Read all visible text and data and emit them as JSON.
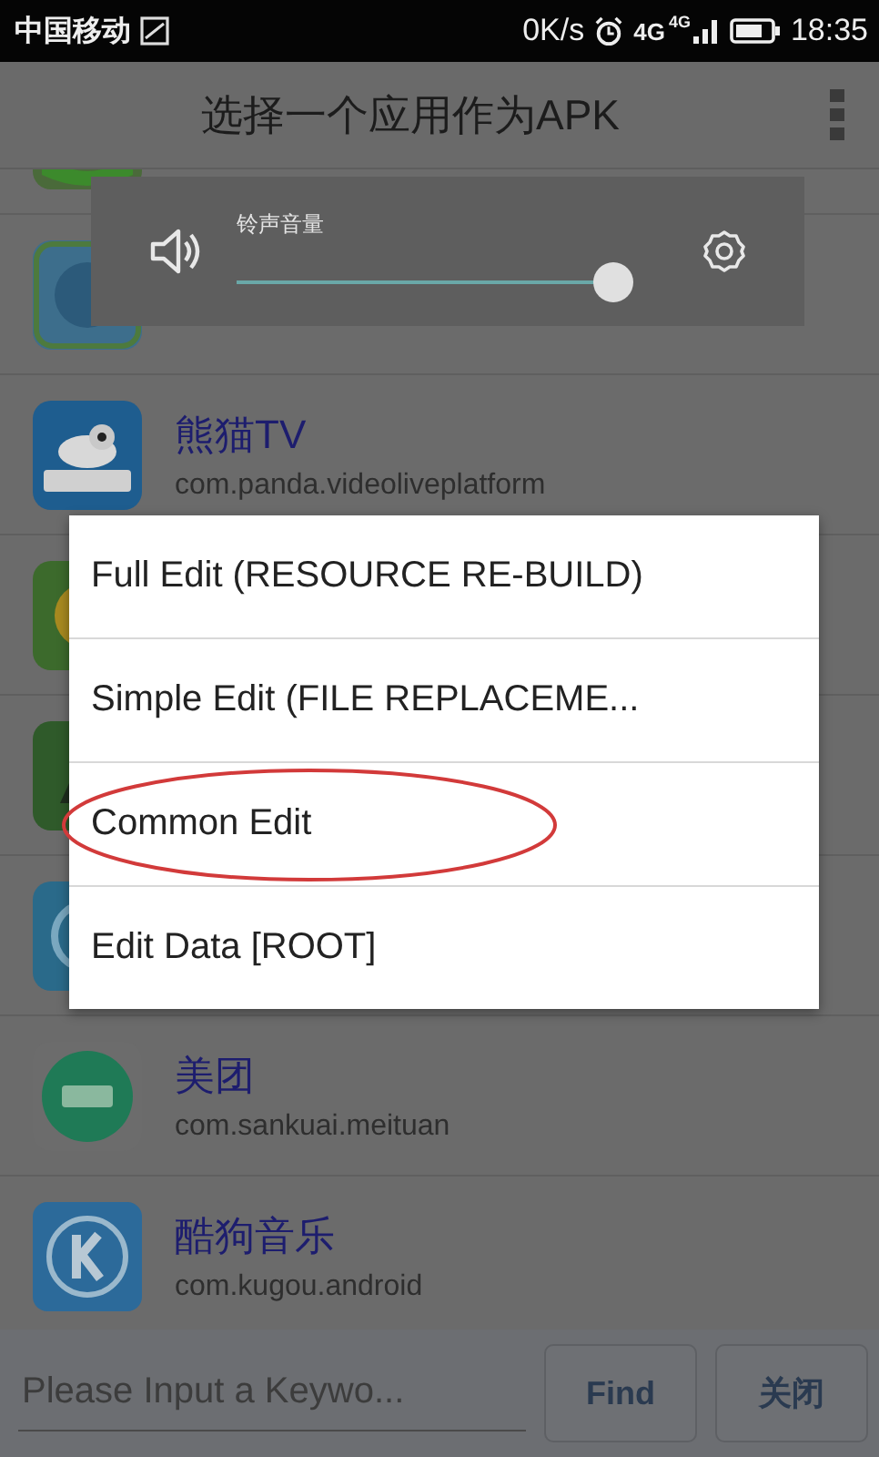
{
  "status_bar": {
    "carrier": "中国移动",
    "speed": "0K/s",
    "network": "4G",
    "network_small": "4G",
    "time": "18:35"
  },
  "toolbar": {
    "title": "选择一个应用作为APK"
  },
  "volume_panel": {
    "label": "铃声音量",
    "level": 0.98
  },
  "apps": [
    {
      "name": "熊猫TV",
      "package": "com.panda.videoliveplatform"
    },
    {
      "name": "美团",
      "package": "com.sankuai.meituan"
    },
    {
      "name": "酷狗音乐",
      "package": "com.kugou.android"
    }
  ],
  "dialog": {
    "options": [
      {
        "label": "Full Edit (RESOURCE RE-BUILD)",
        "circled": false
      },
      {
        "label": "Simple Edit (FILE REPLACEME...",
        "circled": false
      },
      {
        "label": "Common Edit",
        "circled": true
      },
      {
        "label": "Edit Data [ROOT]",
        "circled": false
      }
    ]
  },
  "search": {
    "placeholder": "Please Input a Keywo..."
  },
  "buttons": [
    "Find",
    "关闭"
  ]
}
